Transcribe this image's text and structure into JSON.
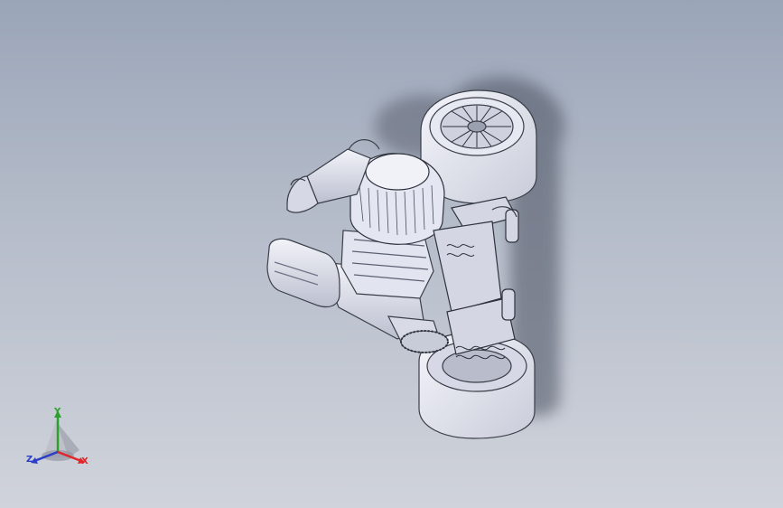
{
  "viewport": {
    "background_top": "#9aa5b8",
    "background_bottom": "#d0d3db"
  },
  "model": {
    "icon": "rc-car-chassis-assembly",
    "part_color": "#e8ebf5",
    "edge_color": "#3a3e48"
  },
  "triad": {
    "x_label": "X",
    "y_label": "Y",
    "z_label": "Z",
    "x_color": "#e0262b",
    "y_color": "#2ca02c",
    "z_color": "#2a3cc8"
  }
}
